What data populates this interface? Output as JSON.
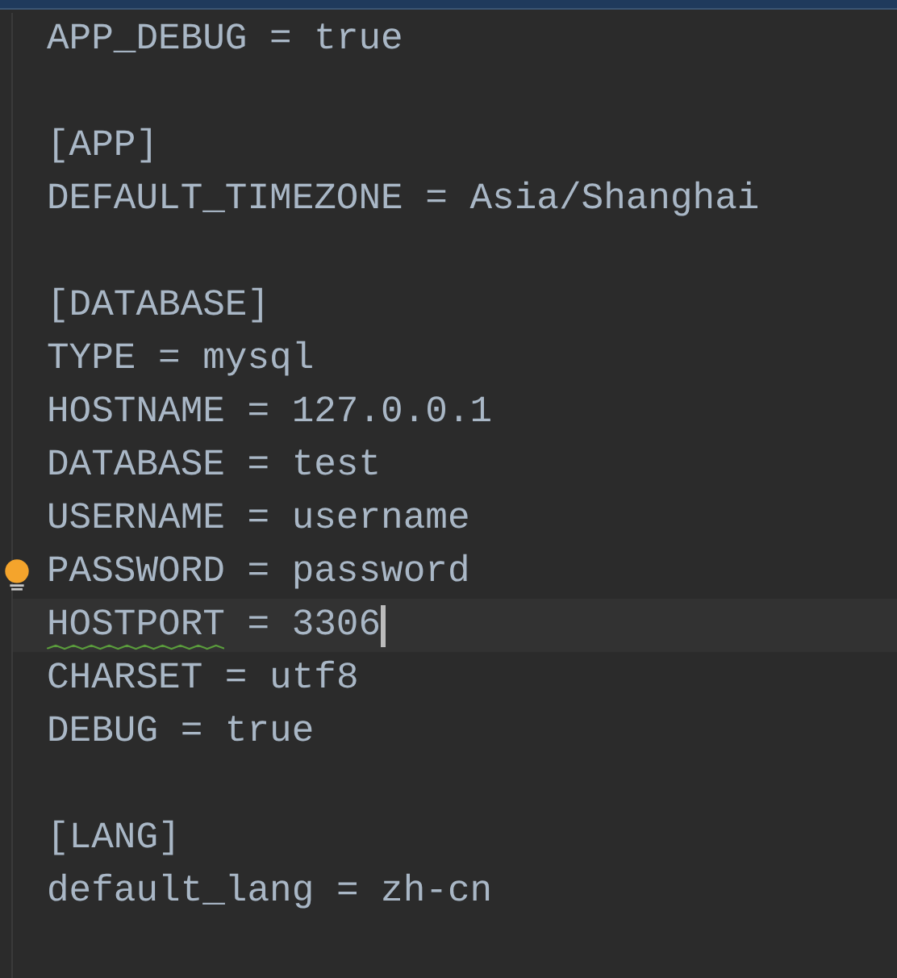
{
  "editor": {
    "lines": [
      {
        "kind": "code",
        "text": "APP_DEBUG = true",
        "current": false,
        "hint": false,
        "typo": false
      },
      {
        "kind": "blank"
      },
      {
        "kind": "code",
        "text": "[APP]",
        "current": false,
        "hint": false,
        "typo": false
      },
      {
        "kind": "code",
        "text": "DEFAULT_TIMEZONE = Asia/Shanghai",
        "current": false,
        "hint": false,
        "typo": false
      },
      {
        "kind": "blank"
      },
      {
        "kind": "code",
        "text": "[DATABASE]",
        "current": false,
        "hint": false,
        "typo": false
      },
      {
        "kind": "code",
        "text": "TYPE = mysql",
        "current": false,
        "hint": false,
        "typo": false
      },
      {
        "kind": "code",
        "text": "HOSTNAME = 127.0.0.1",
        "current": false,
        "hint": false,
        "typo": false
      },
      {
        "kind": "code",
        "text": "DATABASE = test",
        "current": false,
        "hint": false,
        "typo": false
      },
      {
        "kind": "code",
        "text": "USERNAME = username",
        "current": false,
        "hint": false,
        "typo": false
      },
      {
        "kind": "code",
        "text": "PASSWORD = password",
        "current": false,
        "hint": true,
        "typo": false
      },
      {
        "kind": "code",
        "text": "HOSTPORT = 3306",
        "current": true,
        "hint": false,
        "typo": true
      },
      {
        "kind": "code",
        "text": "CHARSET = utf8",
        "current": false,
        "hint": false,
        "typo": false
      },
      {
        "kind": "code",
        "text": "DEBUG = true",
        "current": false,
        "hint": false,
        "typo": false
      },
      {
        "kind": "blank"
      },
      {
        "kind": "code",
        "text": "[LANG]",
        "current": false,
        "hint": false,
        "typo": false
      },
      {
        "kind": "code",
        "text": "default_lang = zh-cn",
        "current": false,
        "hint": false,
        "typo": false
      }
    ]
  }
}
